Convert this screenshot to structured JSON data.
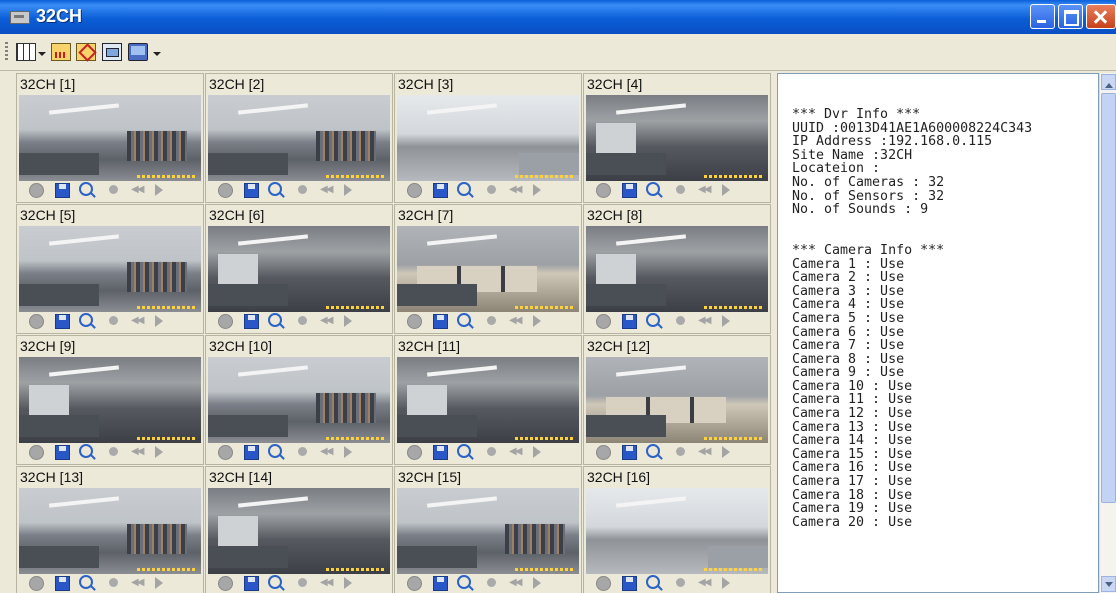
{
  "window": {
    "title": "32CH"
  },
  "toolbar": {
    "items": [
      "grid-icon",
      "dropdown-arrow-icon",
      "bar-chart-icon",
      "diamond-icon",
      "window-icon",
      "monitor-icon",
      "dropdown-arrow-icon"
    ]
  },
  "cameras": [
    {
      "label": "32CH [1]"
    },
    {
      "label": "32CH [2]"
    },
    {
      "label": "32CH [3]"
    },
    {
      "label": "32CH [4]"
    },
    {
      "label": "32CH [5]"
    },
    {
      "label": "32CH [6]"
    },
    {
      "label": "32CH [7]"
    },
    {
      "label": "32CH [8]"
    },
    {
      "label": "32CH [9]"
    },
    {
      "label": "32CH [10]"
    },
    {
      "label": "32CH [11]"
    },
    {
      "label": "32CH [12]"
    },
    {
      "label": "32CH [13]"
    },
    {
      "label": "32CH [14]"
    },
    {
      "label": "32CH [15]"
    },
    {
      "label": "32CH [16]"
    }
  ],
  "info": {
    "dvr_header": "*** Dvr Info ***",
    "uuid": "UUID :0013D41AE1A600008224C343",
    "ip": "IP Address :192.168.0.115",
    "site": "Site Name :32CH",
    "location": "Locateion :",
    "cameras": "No. of Cameras : 32",
    "sensors": "No. of Sensors : 32",
    "sounds": "No. of Sounds : 9",
    "camera_header": "*** Camera Info ***",
    "camera_lines": [
      "Camera 1 : Use",
      "Camera 2 : Use",
      "Camera 3 : Use",
      "Camera 4 : Use",
      "Camera 5 : Use",
      "Camera 6 : Use",
      "Camera 7 : Use",
      "Camera 8 : Use",
      "Camera 9 : Use",
      "Camera 10 : Use",
      "Camera 11 : Use",
      "Camera 12 : Use",
      "Camera 13 : Use",
      "Camera 14 : Use",
      "Camera 15 : Use",
      "Camera 16 : Use",
      "Camera 17 : Use",
      "Camera 18 : Use",
      "Camera 19 : Use",
      "Camera 20 : Use"
    ]
  }
}
